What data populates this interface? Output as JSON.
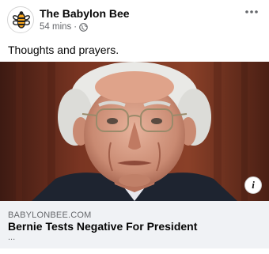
{
  "post": {
    "page_name": "The Babylon Bee",
    "time_ago": "54 mins",
    "separator": "·",
    "privacy_icon": "globe-icon",
    "more_icon": "more-dots-icon",
    "caption": "Thoughts and prayers."
  },
  "link_preview": {
    "domain": "BABYLONBEE.COM",
    "headline": "Bernie Tests Negative For President",
    "subtitle": "...",
    "info_label": "i"
  },
  "colors": {
    "secondary_text": "#65676b",
    "preview_bg": "#f0f2f5",
    "bee_orange": "#f7a51c"
  }
}
